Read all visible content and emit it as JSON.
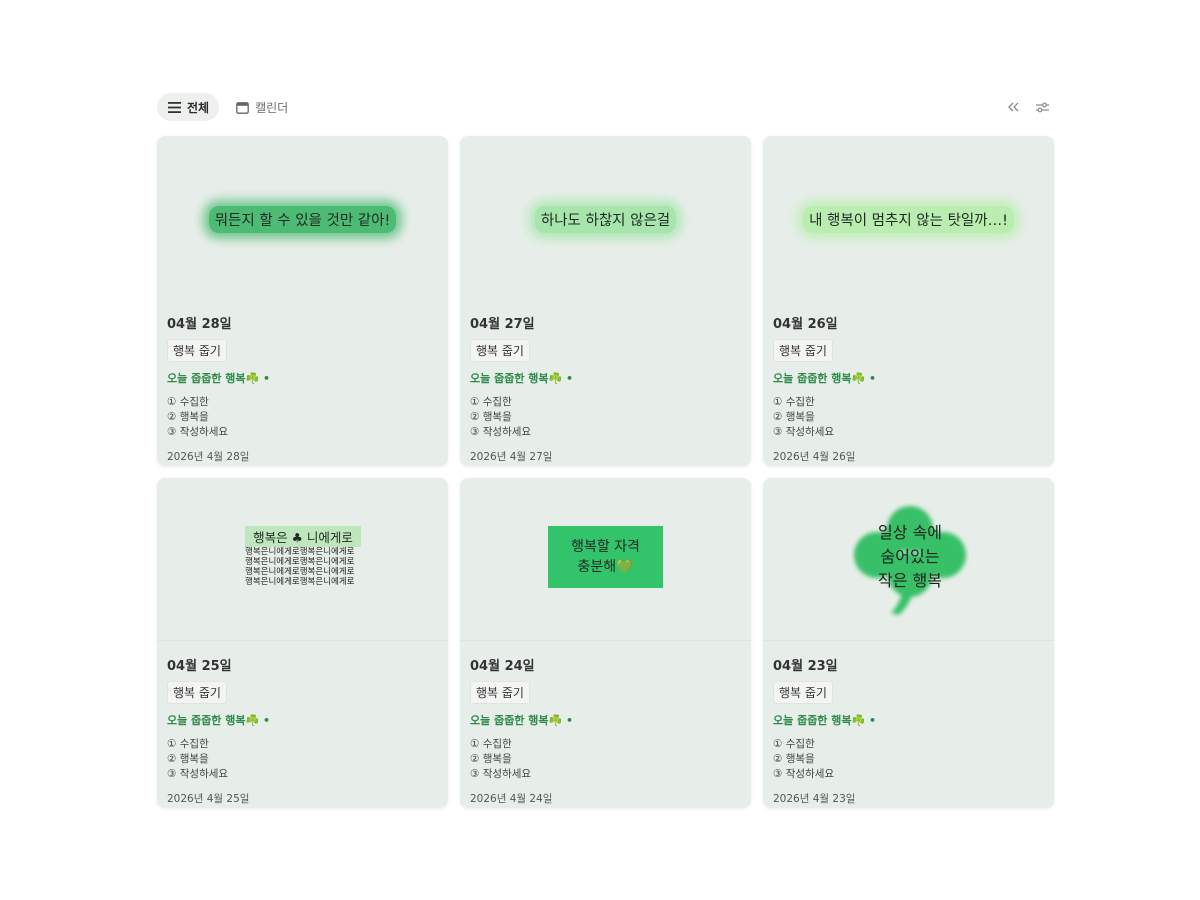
{
  "toolbar": {
    "tabs": [
      {
        "label": "전체",
        "icon": "list-icon",
        "active": true
      },
      {
        "label": "캘린더",
        "icon": "calendar-icon",
        "active": false
      }
    ],
    "tools": [
      {
        "icon": "double-chevron-left-icon"
      },
      {
        "icon": "sliders-icon"
      }
    ]
  },
  "colors": {
    "card_bg": "#e7eee9",
    "accent_green": "#2f8a4b",
    "glow_dark": "#4dbb74",
    "glow_light": "#a6e6ad",
    "box_green": "#33c36b",
    "clover": "#38c068"
  },
  "cards": [
    {
      "cover_text": "뭐든지 할 수 있을 것만 같아!",
      "title": "04월 28일",
      "tag": "행복 줍기",
      "subtitle": "오늘 줍줍한 행복☘️ •",
      "steps": [
        "① 수집한",
        "② 행복을",
        "③ 작성하세요"
      ],
      "date": "2026년 4월 28일"
    },
    {
      "cover_text": "하나도 하찮지 않은걸",
      "title": "04월 27일",
      "tag": "행복 줍기",
      "subtitle": "오늘 줍줍한 행복☘️ •",
      "steps": [
        "① 수집한",
        "② 행복을",
        "③ 작성하세요"
      ],
      "date": "2026년 4월 27일"
    },
    {
      "cover_text": "내 행복이 멈추지 않는 탓일까…!",
      "title": "04월 26일",
      "tag": "행복 줍기",
      "subtitle": "오늘 줍줍한 행복☘️ •",
      "steps": [
        "① 수집한",
        "② 행복을",
        "③ 작성하세요"
      ],
      "date": "2026년 4월 26일"
    },
    {
      "cover_head": "행복은 ♣ 니에게로",
      "cover_lines": [
        "행복은니에게로행복은니에게로",
        "행복은니에게로행복은니에게로",
        "행복은니에게로행복은니에게로",
        "행복은니에게로행복은니에게로"
      ],
      "title": "04월 25일",
      "tag": "행복 줍기",
      "subtitle": "오늘 줍줍한 행복☘️ •",
      "steps": [
        "① 수집한",
        "② 행복을",
        "③ 작성하세요"
      ],
      "date": "2026년 4월 25일"
    },
    {
      "cover_line1": "행복할 자격",
      "cover_line2": "충분해💚",
      "title": "04월 24일",
      "tag": "행복 줍기",
      "subtitle": "오늘 줍줍한 행복☘️ •",
      "steps": [
        "① 수집한",
        "② 행복을",
        "③ 작성하세요"
      ],
      "date": "2026년 4월 24일"
    },
    {
      "cover_line1": "일상 속에",
      "cover_line2": "숨어있는",
      "cover_line3": "작은 행복",
      "title": "04월 23일",
      "tag": "행복 줍기",
      "subtitle": "오늘 줍줍한 행복☘️ •",
      "steps": [
        "① 수집한",
        "② 행복을",
        "③ 작성하세요"
      ],
      "date": "2026년 4월 23일"
    }
  ]
}
